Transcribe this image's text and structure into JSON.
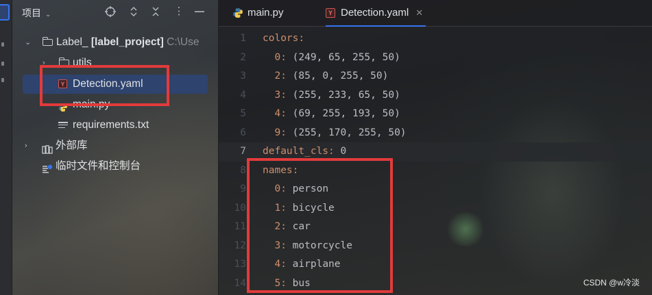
{
  "project_panel": {
    "title": "项目",
    "tree": {
      "root": {
        "name": "Label_",
        "project_name": "[label_project]",
        "path_hint": "C:\\Use"
      },
      "utils": "utils",
      "detection_file": "Detection.yaml",
      "main_file": "main.py",
      "requirements_file": "requirements.txt",
      "external_libs": "外部库",
      "scratches": "临时文件和控制台"
    }
  },
  "editor": {
    "tabs": [
      {
        "label": "main.py",
        "active": false
      },
      {
        "label": "Detection.yaml",
        "active": true
      }
    ],
    "lines": [
      {
        "num": "1",
        "indent": "",
        "key": "colors:",
        "value": ""
      },
      {
        "num": "2",
        "indent": "  ",
        "key": "0:",
        "value": " (249, 65, 255, 50)"
      },
      {
        "num": "3",
        "indent": "  ",
        "key": "2:",
        "value": " (85, 0, 255, 50)"
      },
      {
        "num": "4",
        "indent": "  ",
        "key": "3:",
        "value": " (255, 233, 65, 50)"
      },
      {
        "num": "5",
        "indent": "  ",
        "key": "4:",
        "value": " (69, 255, 193, 50)"
      },
      {
        "num": "6",
        "indent": "  ",
        "key": "9:",
        "value": " (255, 170, 255, 50)"
      },
      {
        "num": "7",
        "indent": "",
        "key": "default_cls:",
        "value": " 0"
      },
      {
        "num": "8",
        "indent": "",
        "key": "names:",
        "value": ""
      },
      {
        "num": "9",
        "indent": "  ",
        "key": "0:",
        "value": " person"
      },
      {
        "num": "10",
        "indent": "  ",
        "key": "1:",
        "value": " bicycle"
      },
      {
        "num": "11",
        "indent": "  ",
        "key": "2:",
        "value": " car"
      },
      {
        "num": "12",
        "indent": "  ",
        "key": "3:",
        "value": " motorcycle"
      },
      {
        "num": "13",
        "indent": "  ",
        "key": "4:",
        "value": " airplane"
      },
      {
        "num": "14",
        "indent": "  ",
        "key": "5:",
        "value": " bus"
      }
    ],
    "current_line": "7"
  },
  "watermark": "CSDN @w冷淡",
  "colors": {
    "accent": "#3574f0",
    "highlight_box": "#e23b3b",
    "yaml_key": "#cf8e6d"
  }
}
